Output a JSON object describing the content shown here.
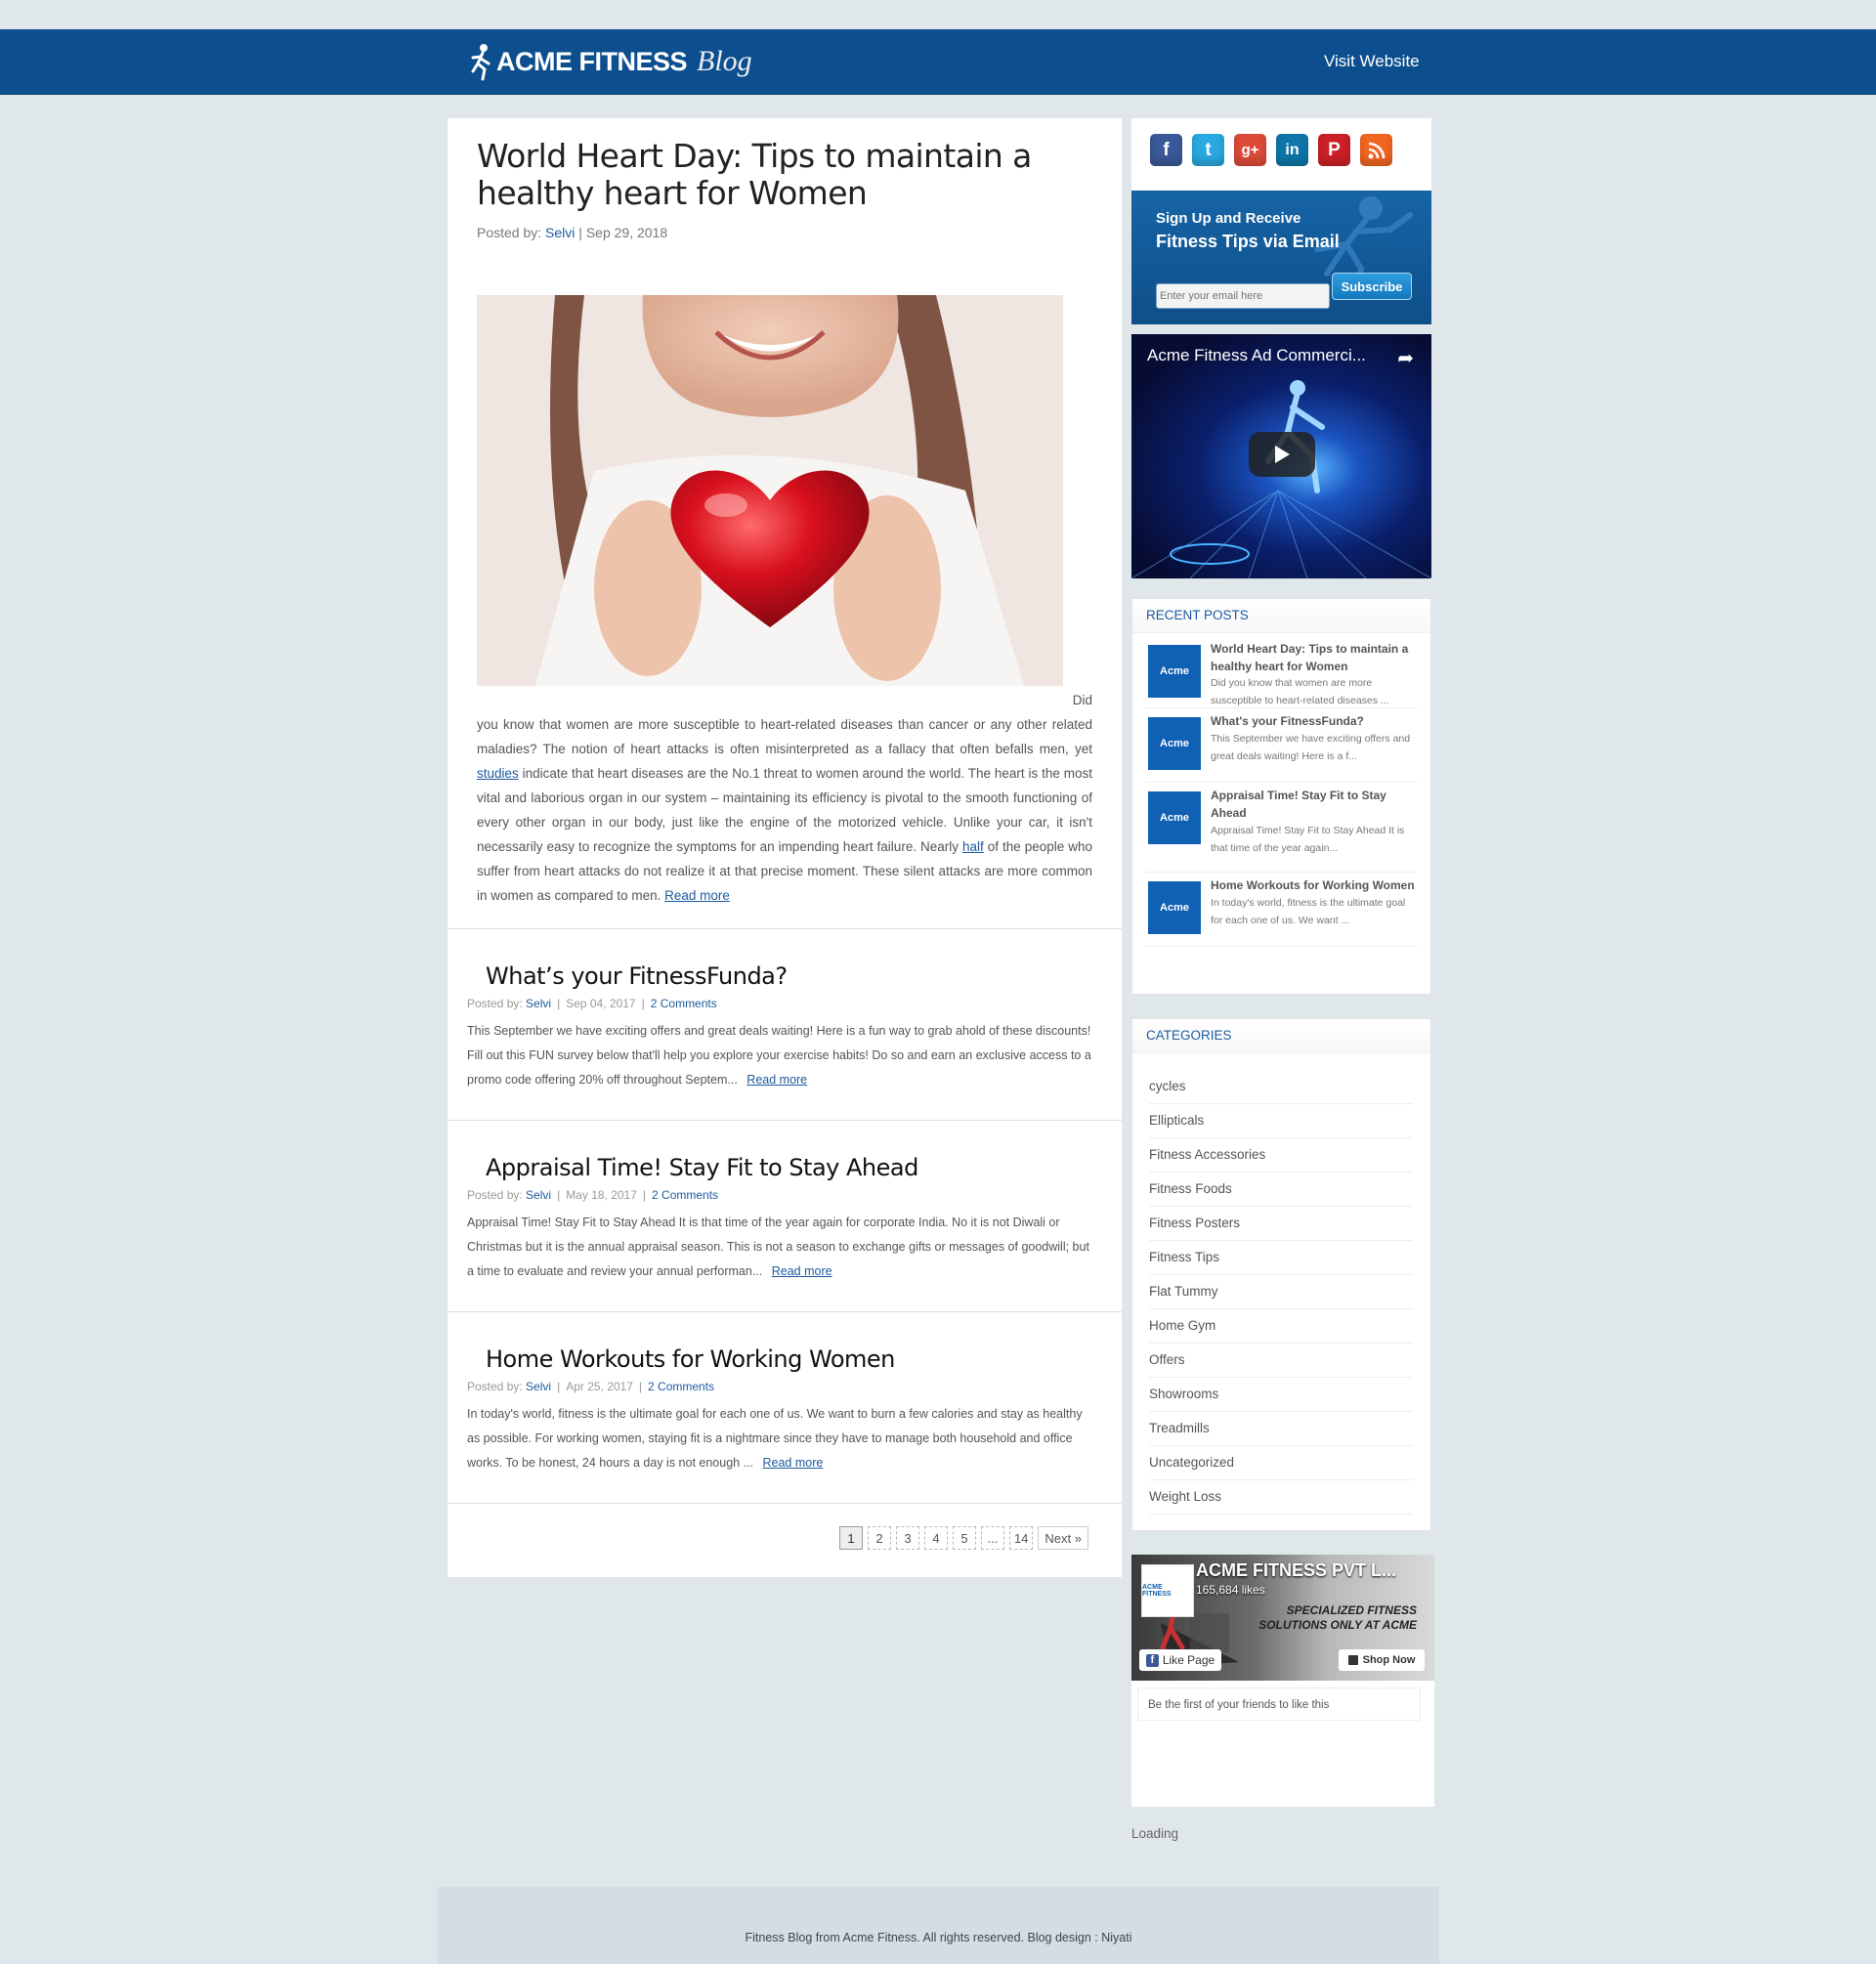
{
  "header": {
    "logo_text": "ACME FITNESS",
    "logo_blog": "Blog",
    "visit_link": "Visit Website"
  },
  "featured": {
    "title": "World Heart Day: Tips to maintain a healthy heart for Women",
    "posted_by_label": "Posted by:",
    "author": "Selvi",
    "date_sep": "|",
    "date": "Sep 29, 2018",
    "image_alt": "Woman holding red heart",
    "did": "Did",
    "body_1": "you know that women are more susceptible to heart-related diseases than cancer or any other related maladies? The notion of heart attacks is often misinterpreted as a fallacy that often befalls men, yet",
    "link_studies": "studies",
    "body_2": "indicate that heart diseases are the No.1 threat to women around the world. The heart is the most vital and laborious organ in our system – maintaining its efficiency is pivotal to the smooth functioning of every other organ in our body, just like the engine of the motorized vehicle. Unlike your car, it isn't necessarily easy to recognize the symptoms for an impending heart failure. Nearly",
    "link_half": "half",
    "body_3": "of the people who suffer from heart attacks do not realize it at that precise moment. These silent attacks are more common in women as compared to men.",
    "read_more": "Read more"
  },
  "posts": [
    {
      "title": "What’s your FitnessFunda?",
      "posted_by_label": "Posted by:",
      "author": "Selvi",
      "date": "Sep 04, 2017",
      "comments": "2 Comments",
      "excerpt": "This September we have exciting offers and great deals waiting! Here is a fun way to grab ahold of these discounts! Fill out this FUN survey below that'll help you explore your exercise habits! Do so and earn an exclusive access to a promo code offering 20% off throughout Septem...",
      "read_more": "Read more"
    },
    {
      "title": "Appraisal Time! Stay Fit to Stay Ahead",
      "posted_by_label": "Posted by:",
      "author": "Selvi",
      "date": "May 18, 2017",
      "comments": "2 Comments",
      "excerpt": "Appraisal Time! Stay Fit to Stay Ahead It is that time of the year again for corporate India. No it is not Diwali or Christmas but it is the annual appraisal season. This is not a season to exchange gifts or messages of goodwill; but a time to evaluate and review your annual performan...",
      "read_more": "Read more"
    },
    {
      "title": "Home Workouts for Working Women",
      "posted_by_label": "Posted by:",
      "author": "Selvi",
      "date": "Apr 25, 2017",
      "comments": "2 Comments",
      "excerpt": "In today's world, fitness is the ultimate goal for each one of us. We want to burn a few calories and stay as healthy as possible. For working women, staying fit is a nightmare since they have to manage both household and office works. To be honest, 24 hours a day is not enough ...",
      "read_more": "Read more"
    }
  ],
  "pagination": {
    "pages": [
      "1",
      "2",
      "3",
      "4",
      "5",
      "...",
      "14"
    ],
    "current": "1",
    "next": "Next »"
  },
  "social": {
    "icons": [
      "facebook-icon",
      "twitter-icon",
      "google-plus-icon",
      "linkedin-icon",
      "pinterest-icon",
      "rss-icon"
    ],
    "colors": [
      "#3b5998",
      "#29a9e1",
      "#dd4b39",
      "#0e76a8",
      "#cb2027",
      "#f26522"
    ]
  },
  "signup": {
    "line1": "Sign Up and Receive",
    "line2": "Fitness Tips via Email",
    "placeholder": "Enter your email here",
    "button": "Subscribe"
  },
  "video": {
    "title": "Acme Fitness Ad Commerci..."
  },
  "recent_posts": {
    "heading": "RECENT POSTS",
    "thumb_label": "Acme",
    "items": [
      {
        "title": "World Heart Day: Tips to maintain a healthy heart for Women",
        "excerpt": "Did you know that women are more susceptible to heart-related diseases ..."
      },
      {
        "title": "What's your FitnessFunda?",
        "excerpt": "This September we have exciting offers and great deals waiting! Here is a f..."
      },
      {
        "title": "Appraisal Time! Stay Fit to Stay Ahead",
        "excerpt": "Appraisal Time! Stay Fit to Stay Ahead It is that time of the year again..."
      },
      {
        "title": "Home Workouts for Working Women",
        "excerpt": "In today's world, fitness is the ultimate goal for each one of us. We want ..."
      }
    ]
  },
  "categories": {
    "heading": "CATEGORIES",
    "items": [
      "cycles",
      "Ellipticals",
      "Fitness Accessories",
      "Fitness Foods",
      "Fitness Posters",
      "Fitness Tips",
      "Flat Tummy",
      "Home Gym",
      "Offers",
      "Showrooms",
      "Treadmills",
      "Uncategorized",
      "Weight Loss"
    ]
  },
  "facebook": {
    "page_name": "ACME FITNESS PVT L...",
    "likes": "165,684 likes",
    "logo_text": "ACME FITNESS",
    "slogan_1": "SPECIALIZED FITNESS",
    "slogan_2": "SOLUTIONS ONLY AT ACME",
    "like_button": "Like Page",
    "shop_button": "Shop Now",
    "friends_text": "Be the first of your friends to like this"
  },
  "loading": "Loading",
  "footer": {
    "text": "Fitness Blog from Acme Fitness. All rights reserved. Blog design : Niyati"
  }
}
